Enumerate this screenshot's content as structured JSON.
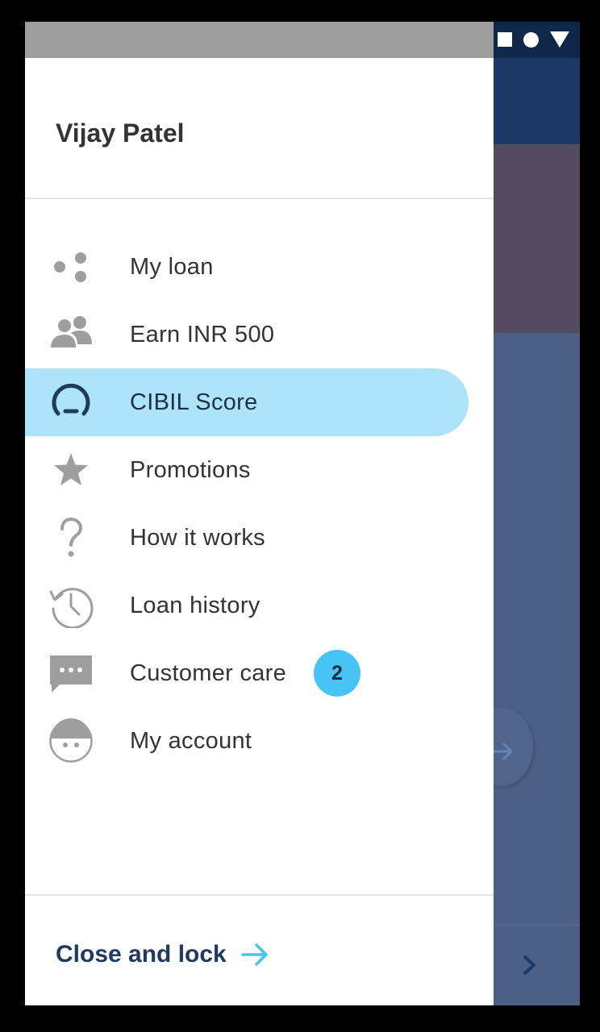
{
  "drawer": {
    "user_name": "Vijay Patel",
    "menu": [
      {
        "label": "My loan",
        "icon": "dots-icon"
      },
      {
        "label": "Earn INR 500",
        "icon": "people-icon"
      },
      {
        "label": "CIBIL Score",
        "icon": "gauge-icon",
        "active": true
      },
      {
        "label": "Promotions",
        "icon": "star-icon"
      },
      {
        "label": "How it works",
        "icon": "question-icon"
      },
      {
        "label": "Loan history",
        "icon": "history-icon"
      },
      {
        "label": "Customer care",
        "icon": "chat-icon",
        "badge": "2"
      },
      {
        "label": "My account",
        "icon": "face-icon"
      }
    ],
    "close_lock_label": "Close and lock"
  },
  "colors": {
    "active_item_bg": "#aee4fb",
    "badge_bg": "#47c4f4",
    "link_color": "#1e3a5f",
    "arrow_color": "#47c4f4"
  }
}
